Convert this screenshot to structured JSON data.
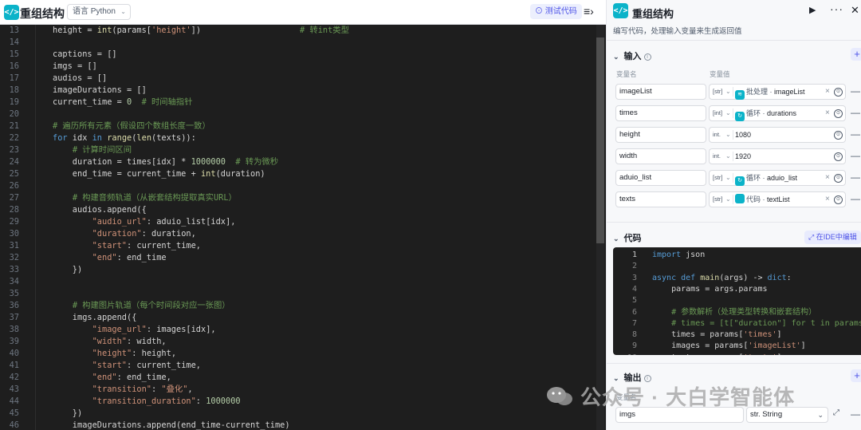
{
  "left_header": {
    "title": "重组结构",
    "language_select": "语言 Python",
    "test_button": "测试代码",
    "logo_glyph": "</>"
  },
  "code_lines": [
    {
      "n": "13",
      "parts": [
        [
          "",
          "height = "
        ],
        [
          "fn",
          "int"
        ],
        [
          "",
          "(params["
        ],
        [
          "str",
          "'height'"
        ],
        [
          "",
          "])                    "
        ],
        [
          "cm",
          "# 转int类型"
        ]
      ]
    },
    {
      "n": "14",
      "parts": []
    },
    {
      "n": "15",
      "parts": [
        [
          "",
          "captions = []"
        ]
      ]
    },
    {
      "n": "16",
      "parts": [
        [
          "",
          "imgs = []"
        ]
      ]
    },
    {
      "n": "17",
      "parts": [
        [
          "",
          "audios = []"
        ]
      ]
    },
    {
      "n": "18",
      "parts": [
        [
          "",
          "imageDurations = []"
        ]
      ]
    },
    {
      "n": "19",
      "parts": [
        [
          "",
          "current_time = "
        ],
        [
          "num",
          "0"
        ],
        [
          "",
          "  "
        ],
        [
          "cm",
          "# 时间轴指针"
        ]
      ]
    },
    {
      "n": "20",
      "parts": []
    },
    {
      "n": "21",
      "parts": [
        [
          "cm",
          "# 遍历所有元素（假设四个数组长度一致）"
        ]
      ]
    },
    {
      "n": "22",
      "parts": [
        [
          "kw",
          "for"
        ],
        [
          "",
          " idx "
        ],
        [
          "kw",
          "in"
        ],
        [
          "",
          " "
        ],
        [
          "fn",
          "range"
        ],
        [
          "",
          "("
        ],
        [
          "fn",
          "len"
        ],
        [
          "",
          "(texts)):"
        ]
      ]
    },
    {
      "n": "23",
      "parts": [
        [
          "",
          "    "
        ],
        [
          "cm",
          "# 计算时间区间"
        ]
      ]
    },
    {
      "n": "24",
      "parts": [
        [
          "",
          "    duration = times[idx] * "
        ],
        [
          "num",
          "1000000"
        ],
        [
          "",
          "  "
        ],
        [
          "cm",
          "# 转为微秒"
        ]
      ]
    },
    {
      "n": "25",
      "parts": [
        [
          "",
          "    end_time = current_time + "
        ],
        [
          "fn",
          "int"
        ],
        [
          "",
          "(duration)"
        ]
      ]
    },
    {
      "n": "26",
      "parts": []
    },
    {
      "n": "27",
      "parts": [
        [
          "",
          "    "
        ],
        [
          "cm",
          "# 构建音频轨道（从嵌套结构提取真实URL）"
        ]
      ]
    },
    {
      "n": "28",
      "parts": [
        [
          "",
          "    audios.append({"
        ]
      ]
    },
    {
      "n": "29",
      "parts": [
        [
          "",
          "        "
        ],
        [
          "str",
          "\"audio_url\""
        ],
        [
          "",
          ": aduio_list[idx],"
        ]
      ]
    },
    {
      "n": "30",
      "parts": [
        [
          "",
          "        "
        ],
        [
          "str",
          "\"duration\""
        ],
        [
          "",
          ": duration,"
        ]
      ]
    },
    {
      "n": "31",
      "parts": [
        [
          "",
          "        "
        ],
        [
          "str",
          "\"start\""
        ],
        [
          "",
          ": current_time,"
        ]
      ]
    },
    {
      "n": "32",
      "parts": [
        [
          "",
          "        "
        ],
        [
          "str",
          "\"end\""
        ],
        [
          "",
          ": end_time"
        ]
      ]
    },
    {
      "n": "33",
      "parts": [
        [
          "",
          "    })"
        ]
      ]
    },
    {
      "n": "34",
      "parts": []
    },
    {
      "n": "35",
      "parts": []
    },
    {
      "n": "36",
      "parts": [
        [
          "",
          "    "
        ],
        [
          "cm",
          "# 构建图片轨道（每个时间段对应一张图）"
        ]
      ]
    },
    {
      "n": "37",
      "parts": [
        [
          "",
          "    imgs.append({"
        ]
      ]
    },
    {
      "n": "38",
      "parts": [
        [
          "",
          "        "
        ],
        [
          "str",
          "\"image_url\""
        ],
        [
          "",
          ": images[idx],"
        ]
      ]
    },
    {
      "n": "39",
      "parts": [
        [
          "",
          "        "
        ],
        [
          "str",
          "\"width\""
        ],
        [
          "",
          ": width,"
        ]
      ]
    },
    {
      "n": "40",
      "parts": [
        [
          "",
          "        "
        ],
        [
          "str",
          "\"height\""
        ],
        [
          "",
          ": height,"
        ]
      ]
    },
    {
      "n": "41",
      "parts": [
        [
          "",
          "        "
        ],
        [
          "str",
          "\"start\""
        ],
        [
          "",
          ": current_time,"
        ]
      ]
    },
    {
      "n": "42",
      "parts": [
        [
          "",
          "        "
        ],
        [
          "str",
          "\"end\""
        ],
        [
          "",
          ": end_time,"
        ]
      ]
    },
    {
      "n": "43",
      "parts": [
        [
          "",
          "        "
        ],
        [
          "str",
          "\"transition\""
        ],
        [
          "",
          ": "
        ],
        [
          "str",
          "\"叠化\""
        ],
        [
          "",
          ","
        ]
      ]
    },
    {
      "n": "44",
      "parts": [
        [
          "",
          "        "
        ],
        [
          "str",
          "\"transition_duration\""
        ],
        [
          "",
          ": "
        ],
        [
          "num",
          "1000000"
        ]
      ]
    },
    {
      "n": "45",
      "parts": [
        [
          "",
          "    })"
        ]
      ]
    },
    {
      "n": "46",
      "parts": [
        [
          "",
          "    imageDurations.append(end_time-current_time)"
        ]
      ]
    }
  ],
  "right_panel": {
    "title": "重组结构",
    "description": "编写代码，处理输入变量来生成返回值",
    "input_section": {
      "title": "输入",
      "col_name": "变量名",
      "col_value": "变量值",
      "rows": [
        {
          "name": "imageList",
          "type": "[str]",
          "ref_icon": "batch",
          "ref_prefix": "批处理 ·",
          "ref_value": "imageList",
          "icon_color": "#0bb3c9"
        },
        {
          "name": "times",
          "type": "[int]",
          "ref_icon": "loop",
          "ref_prefix": "循环 ·",
          "ref_value": "durations",
          "icon_color": "#0bb3c9"
        },
        {
          "name": "height",
          "type": "int.",
          "ref_icon": "",
          "ref_prefix": "",
          "ref_value": "1080",
          "icon_color": ""
        },
        {
          "name": "width",
          "type": "int.",
          "ref_icon": "",
          "ref_prefix": "",
          "ref_value": "1920",
          "icon_color": ""
        },
        {
          "name": "aduio_list",
          "type": "[str]",
          "ref_icon": "loop",
          "ref_prefix": "循环 ·",
          "ref_value": "aduio_list",
          "icon_color": "#0bb3c9"
        },
        {
          "name": "texts",
          "type": "[str]",
          "ref_icon": "code",
          "ref_prefix": "代码 ·",
          "ref_value": "textList",
          "icon_color": "#0bb3c9"
        }
      ]
    },
    "code_section": {
      "title": "代码",
      "ide_button": "在IDE中编辑",
      "lines": [
        {
          "n": "1",
          "parts": [
            [
              "kw",
              "import"
            ],
            [
              "",
              " json"
            ]
          ]
        },
        {
          "n": "2",
          "parts": []
        },
        {
          "n": "3",
          "parts": [
            [
              "kw",
              "async def"
            ],
            [
              "",
              " "
            ],
            [
              "fn",
              "main"
            ],
            [
              "",
              "(args) -> "
            ],
            [
              "kw",
              "dict"
            ],
            [
              "",
              ":"
            ]
          ]
        },
        {
          "n": "4",
          "parts": [
            [
              "",
              "    params = args.params"
            ]
          ]
        },
        {
          "n": "5",
          "parts": []
        },
        {
          "n": "6",
          "parts": [
            [
              "",
              "    "
            ],
            [
              "cm",
              "# 参数解析（处理类型转换和嵌套结构）"
            ]
          ]
        },
        {
          "n": "7",
          "parts": [
            [
              "",
              "    "
            ],
            [
              "cm",
              "# times = [t[\"duration\"] for t in params["
            ]
          ]
        },
        {
          "n": "8",
          "parts": [
            [
              "",
              "    times = params["
            ],
            [
              "str",
              "'times'"
            ],
            [
              "",
              "]"
            ]
          ]
        },
        {
          "n": "9",
          "parts": [
            [
              "",
              "    images = params["
            ],
            [
              "str",
              "'imageList'"
            ],
            [
              "",
              "]"
            ]
          ]
        },
        {
          "n": "10",
          "parts": [
            [
              "",
              "    texts = params["
            ],
            [
              "str",
              "'texts'"
            ],
            [
              "",
              "]"
            ]
          ]
        }
      ]
    },
    "output_section": {
      "title": "输出",
      "col_name": "变量名",
      "rows": [
        {
          "name": "imgs",
          "type": "str. String"
        }
      ]
    }
  },
  "watermark": "公众号 · 大白学智能体",
  "colors": {
    "accent": "#4d53e8",
    "brand": "#0bb3c9",
    "editor_bg": "#1e1e1e"
  }
}
